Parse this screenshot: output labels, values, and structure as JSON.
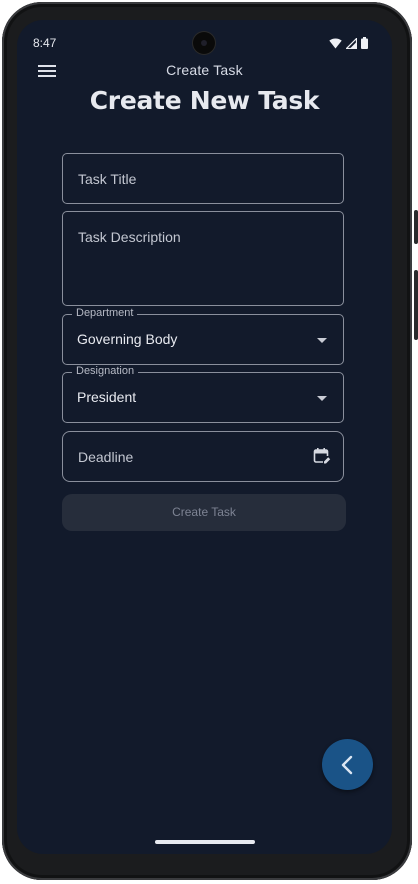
{
  "status_bar": {
    "time": "8:47",
    "icons": [
      "wifi-icon",
      "cell-signal-icon",
      "battery-icon"
    ]
  },
  "app_bar": {
    "title": "Create Task",
    "menu_icon": "hamburger-menu-icon"
  },
  "page": {
    "heading": "Create New Task"
  },
  "form": {
    "task_title": {
      "placeholder": "Task Title",
      "value": ""
    },
    "task_description": {
      "placeholder": "Task Description",
      "value": ""
    },
    "department": {
      "label": "Department",
      "selected": "Governing Body"
    },
    "designation": {
      "label": "Designation",
      "selected": "President"
    },
    "deadline": {
      "placeholder": "Deadline",
      "icon": "calendar-edit-icon"
    },
    "submit_label": "Create Task"
  },
  "fab": {
    "icon": "chevron-left-icon"
  },
  "colors": {
    "background": "#121a2b",
    "fab": "#1a5387",
    "button_disabled": "#262d3b",
    "outline": "#8a8f9c"
  }
}
